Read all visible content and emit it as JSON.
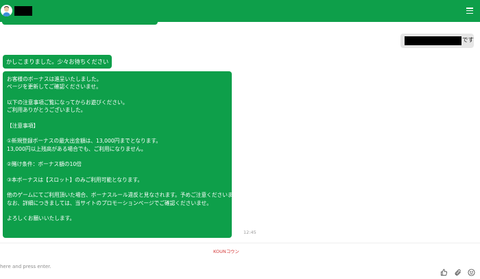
{
  "header": {
    "bg_color": "#0e9f4a",
    "menu_icon": "hamburger-menu-icon",
    "avatar_icon": "avatar-icon"
  },
  "messages": {
    "user_suffix": "です",
    "bot_short": "かしこまりました。少々お待ちください",
    "bot_long": [
      "お客様のボーナスは進呈いたしました。",
      "ページを更新してご確認くださいませ。",
      "",
      "以下の注意事項ご覧になってからお遊びください。",
      "ご利用ありがとうございました。",
      "",
      "【注意事項】",
      "",
      "①新規登録ボーナスの最大出金額は、13,000円までとなります。",
      "13,000円以上残高がある場合でも、ご利用になりません。",
      "",
      "②賭け条件：ボーナス額の10倍",
      "",
      "③本ボーナスは【スロット】のみご利用可能となります。",
      "",
      "他のゲームにてご利用頂いた場合、ボーナスルール違反と見なされます。予めご注意くださいませ。",
      "なお、詳細につきましては、当サイトのプロモーションページでご確認くださいませ。",
      "",
      "よろしくお願いいたします。"
    ],
    "time": "12:45"
  },
  "footer": {
    "brand": "KOUNコウン",
    "input_placeholder": "here and press enter.",
    "icons": [
      "thumbs-up-icon",
      "attachment-icon",
      "emoji-icon"
    ]
  }
}
